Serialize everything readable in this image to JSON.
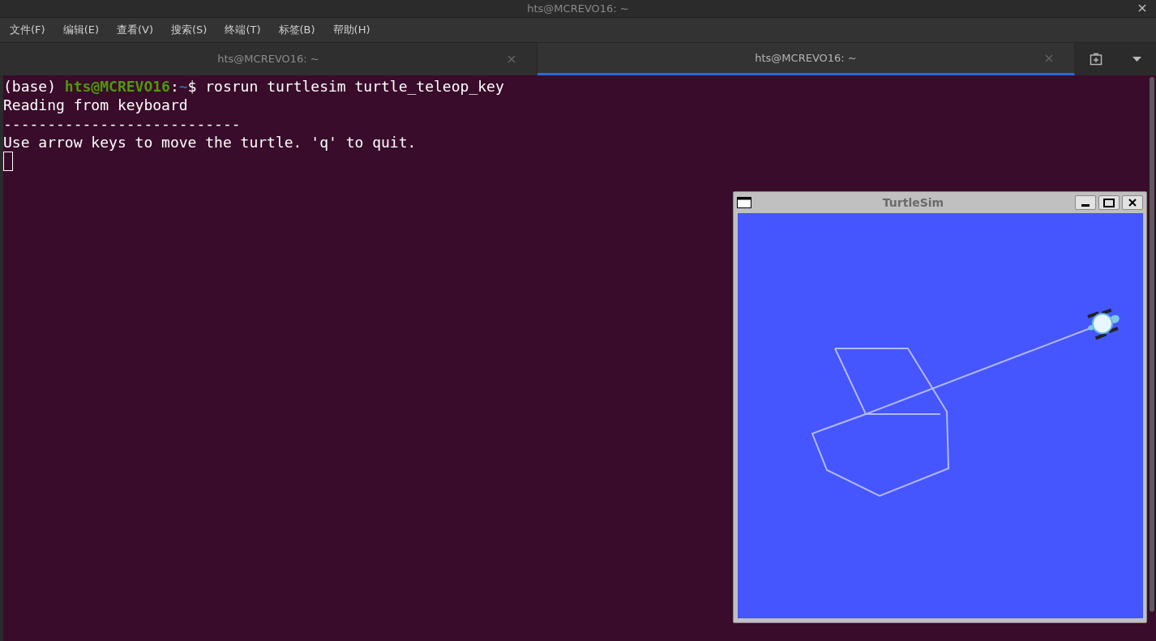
{
  "window": {
    "title": "hts@MCREVO16: ~"
  },
  "menu": [
    "文件(F)",
    "编辑(E)",
    "查看(V)",
    "搜索(S)",
    "终端(T)",
    "标签(B)",
    "帮助(H)"
  ],
  "tabs": [
    {
      "label": "hts@MCREVO16: ~",
      "selected": false
    },
    {
      "label": "hts@MCREVO16: ~",
      "selected": true
    }
  ],
  "terminal": {
    "lines": [
      {
        "segments": [
          {
            "text": "(base) ",
            "color": "#ffffff"
          },
          {
            "text": "hts@MCREVO16",
            "color": "#4e9a06"
          },
          {
            "text": ":",
            "color": "#ffffff"
          },
          {
            "text": "~",
            "color": "#3465a4"
          },
          {
            "text": "$ rosrun turtlesim turtle_teleop_key",
            "color": "#ffffff"
          }
        ]
      },
      {
        "segments": [
          {
            "text": "Reading from keyboard",
            "color": "#ffffff"
          }
        ]
      },
      {
        "segments": [
          {
            "text": "---------------------------",
            "color": "#ffffff"
          }
        ]
      },
      {
        "segments": [
          {
            "text": "Use arrow keys to move the turtle. 'q' to quit.",
            "color": "#ffffff"
          }
        ]
      }
    ],
    "cursor": true
  },
  "turtlesim": {
    "title": "TurtleSim"
  }
}
